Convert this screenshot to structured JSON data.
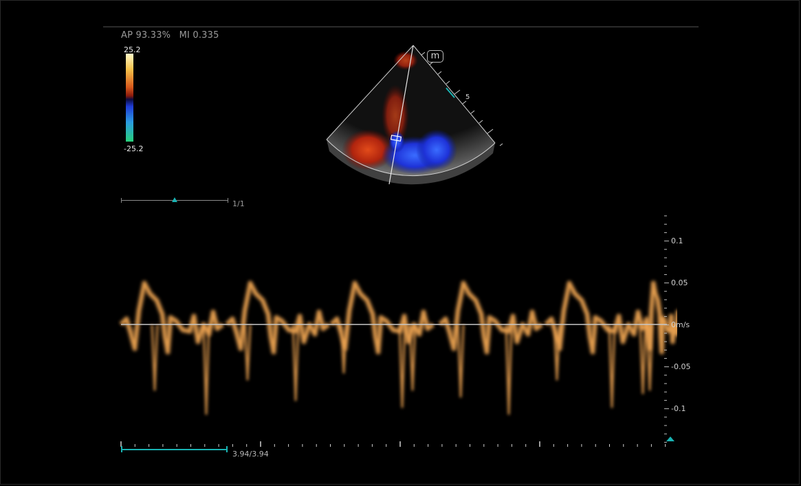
{
  "status": {
    "ap": "AP 93.33%",
    "mi": "MI 0.335"
  },
  "color_scale": {
    "max_label": "25.2",
    "min_label": "-25.2"
  },
  "sector": {
    "badge": "m",
    "depth_label": "5"
  },
  "frame": {
    "label": "1/1"
  },
  "velocity_scale": {
    "ticks": [
      {
        "label": "0.1",
        "value": 0.1
      },
      {
        "label": "0.05",
        "value": 0.05
      },
      {
        "label": "0m/s",
        "value": 0
      },
      {
        "label": "-0.05",
        "value": -0.05
      },
      {
        "label": "-0.1",
        "value": -0.1
      }
    ]
  },
  "timeline": {
    "label": "3.94/3.94"
  },
  "colors": {
    "accent": "#19b3b3",
    "spectrum": "#f0a552",
    "scale_text": "#d0d0d0"
  }
}
